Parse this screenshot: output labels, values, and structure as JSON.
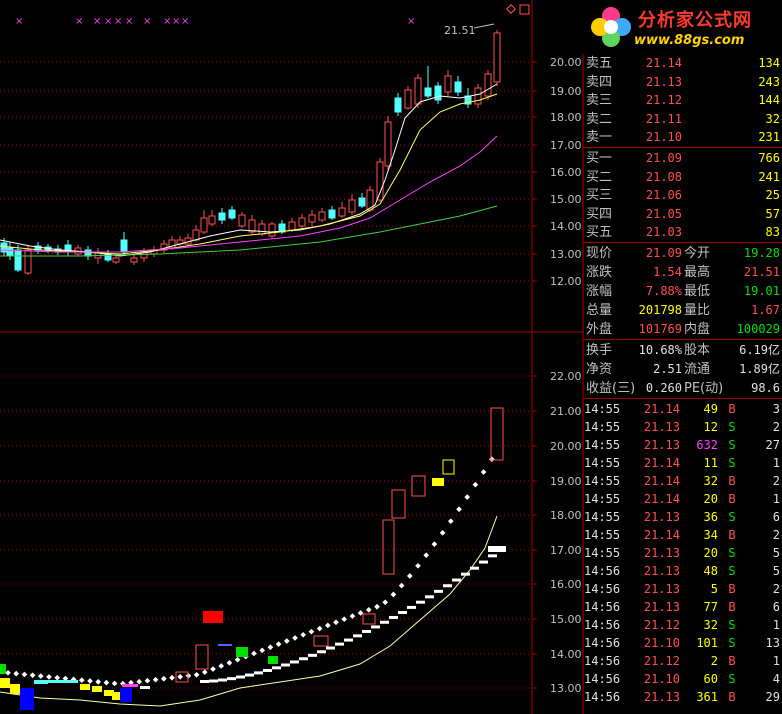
{
  "logo": {
    "title": "分析家公式网",
    "url": "www.88gs.com"
  },
  "upper_axis": [
    "20.00",
    "19.00",
    "18.00",
    "17.00",
    "16.00",
    "15.00",
    "14.00",
    "13.00",
    "12.00"
  ],
  "lower_axis": [
    "22.00",
    "21.00",
    "20.00",
    "19.00",
    "18.00",
    "17.00",
    "16.00",
    "15.00",
    "14.00",
    "13.00"
  ],
  "high_marker": "21.51",
  "order_book": [
    {
      "label": "卖五",
      "price": "21.14",
      "vol": "134"
    },
    {
      "label": "卖四",
      "price": "21.13",
      "vol": "243"
    },
    {
      "label": "卖三",
      "price": "21.12",
      "vol": "144"
    },
    {
      "label": "卖二",
      "price": "21.11",
      "vol": "32"
    },
    {
      "label": "卖一",
      "price": "21.10",
      "vol": "231"
    },
    {
      "label": "买一",
      "price": "21.09",
      "vol": "766"
    },
    {
      "label": "买二",
      "price": "21.08",
      "vol": "241"
    },
    {
      "label": "买三",
      "price": "21.06",
      "vol": "25"
    },
    {
      "label": "买四",
      "price": "21.05",
      "vol": "57"
    },
    {
      "label": "买五",
      "price": "21.03",
      "vol": "83"
    }
  ],
  "quote": [
    {
      "l1": "现价",
      "v1": "21.09",
      "c1": "red",
      "l2": "今开",
      "v2": "19.28",
      "c2": "green"
    },
    {
      "l1": "涨跌",
      "v1": "1.54",
      "c1": "red",
      "l2": "最高",
      "v2": "21.51",
      "c2": "red"
    },
    {
      "l1": "涨幅",
      "v1": "7.88%",
      "c1": "red",
      "l2": "最低",
      "v2": "19.01",
      "c2": "green"
    },
    {
      "l1": "总量",
      "v1": "201798",
      "c1": "yellow",
      "l2": "量比",
      "v2": "1.67",
      "c2": "red"
    },
    {
      "l1": "外盘",
      "v1": "101769",
      "c1": "red",
      "l2": "内盘",
      "v2": "100029",
      "c2": "green"
    }
  ],
  "fundamentals": [
    {
      "l1": "换手",
      "v1": "10.68%",
      "l2": "股本",
      "v2": "6.19亿"
    },
    {
      "l1": "净资",
      "v1": "2.51",
      "l2": "流通",
      "v2": "1.89亿"
    },
    {
      "l1": "收益(三)",
      "v1": "0.260",
      "l2": "PE(动)",
      "v2": "98.6"
    }
  ],
  "ticks": [
    {
      "time": "14:55",
      "price": "21.14",
      "vol": "49",
      "vc": "yellow",
      "side": "B",
      "n": "3"
    },
    {
      "time": "14:55",
      "price": "21.13",
      "vol": "12",
      "vc": "yellow",
      "side": "S",
      "n": "2"
    },
    {
      "time": "14:55",
      "price": "21.13",
      "vol": "632",
      "vc": "magenta",
      "side": "S",
      "n": "27"
    },
    {
      "time": "14:55",
      "price": "21.14",
      "vol": "11",
      "vc": "yellow",
      "side": "S",
      "n": "1"
    },
    {
      "time": "14:55",
      "price": "21.14",
      "vol": "32",
      "vc": "yellow",
      "side": "B",
      "n": "2"
    },
    {
      "time": "14:55",
      "price": "21.14",
      "vol": "20",
      "vc": "yellow",
      "side": "B",
      "n": "1"
    },
    {
      "time": "14:55",
      "price": "21.13",
      "vol": "36",
      "vc": "yellow",
      "side": "S",
      "n": "6"
    },
    {
      "time": "14:55",
      "price": "21.14",
      "vol": "34",
      "vc": "yellow",
      "side": "B",
      "n": "2"
    },
    {
      "time": "14:55",
      "price": "21.13",
      "vol": "20",
      "vc": "yellow",
      "side": "S",
      "n": "5"
    },
    {
      "time": "14:56",
      "price": "21.13",
      "vol": "48",
      "vc": "yellow",
      "side": "S",
      "n": "5"
    },
    {
      "time": "14:56",
      "price": "21.13",
      "vol": "5",
      "vc": "yellow",
      "side": "B",
      "n": "2"
    },
    {
      "time": "14:56",
      "price": "21.13",
      "vol": "77",
      "vc": "yellow",
      "side": "B",
      "n": "6"
    },
    {
      "time": "14:56",
      "price": "21.12",
      "vol": "32",
      "vc": "yellow",
      "side": "S",
      "n": "1"
    },
    {
      "time": "14:56",
      "price": "21.10",
      "vol": "101",
      "vc": "yellow",
      "side": "S",
      "n": "13"
    },
    {
      "time": "14:56",
      "price": "21.12",
      "vol": "2",
      "vc": "yellow",
      "side": "B",
      "n": "1"
    },
    {
      "time": "14:56",
      "price": "21.10",
      "vol": "60",
      "vc": "yellow",
      "side": "S",
      "n": "4"
    },
    {
      "time": "14:56",
      "price": "21.13",
      "vol": "361",
      "vc": "yellow",
      "side": "B",
      "n": "29"
    }
  ],
  "colors": {
    "up": "#ff5050",
    "down": "#54ffff",
    "grid": "#a00000"
  }
}
